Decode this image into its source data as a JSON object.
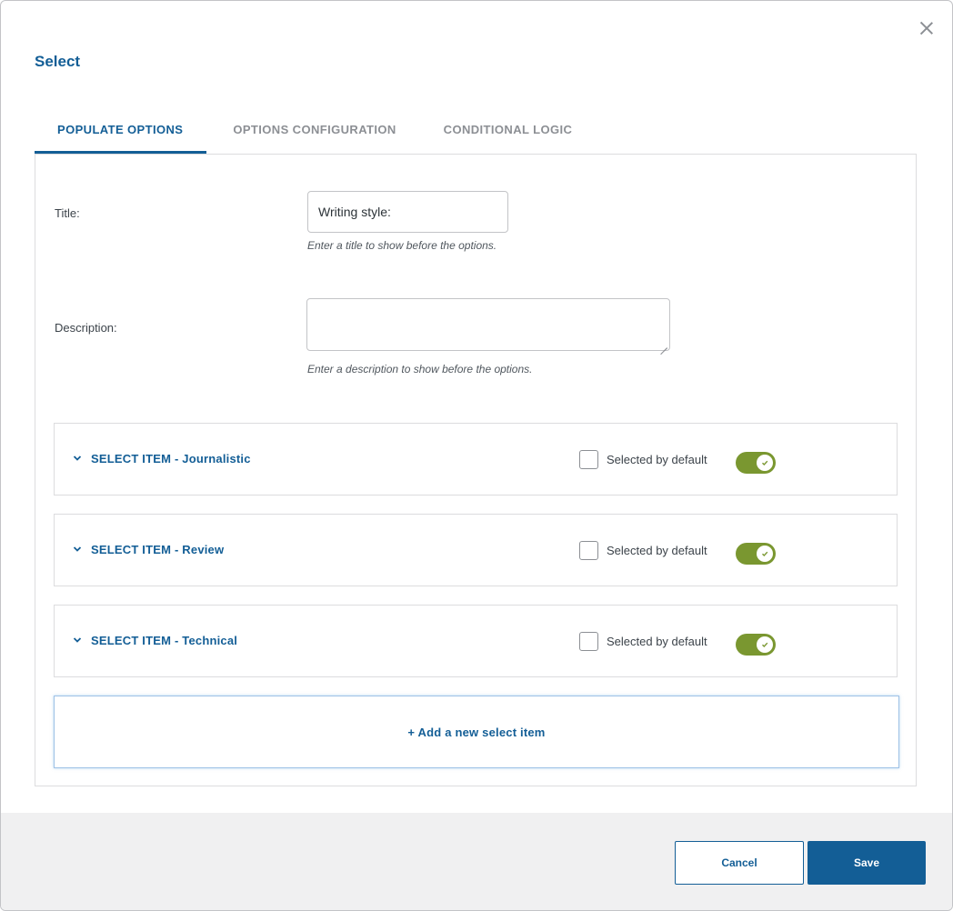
{
  "dialog": {
    "title": "Select",
    "close_icon": "close-icon"
  },
  "tabs": [
    {
      "label": "POPULATE OPTIONS",
      "active": true
    },
    {
      "label": "OPTIONS CONFIGURATION",
      "active": false
    },
    {
      "label": "CONDITIONAL LOGIC",
      "active": false
    }
  ],
  "form": {
    "title_label": "Title:",
    "title_value": "Writing style:",
    "title_help": "Enter a title to show before the options.",
    "description_label": "Description:",
    "description_value": "",
    "description_help": "Enter a description to show before the options."
  },
  "items": [
    {
      "title": "SELECT ITEM - Journalistic",
      "checkbox_label": "Selected by default",
      "selected_by_default": false,
      "enabled": true
    },
    {
      "title": "SELECT ITEM - Review",
      "checkbox_label": "Selected by default",
      "selected_by_default": false,
      "enabled": true
    },
    {
      "title": "SELECT ITEM - Technical",
      "checkbox_label": "Selected by default",
      "selected_by_default": false,
      "enabled": true
    }
  ],
  "add_item_label": "+ Add a new select item",
  "footer": {
    "cancel_label": "Cancel",
    "save_label": "Save"
  },
  "colors": {
    "accent": "#135e96",
    "toggle_on": "#7a9730",
    "footer_bg": "#f0f0f1"
  }
}
